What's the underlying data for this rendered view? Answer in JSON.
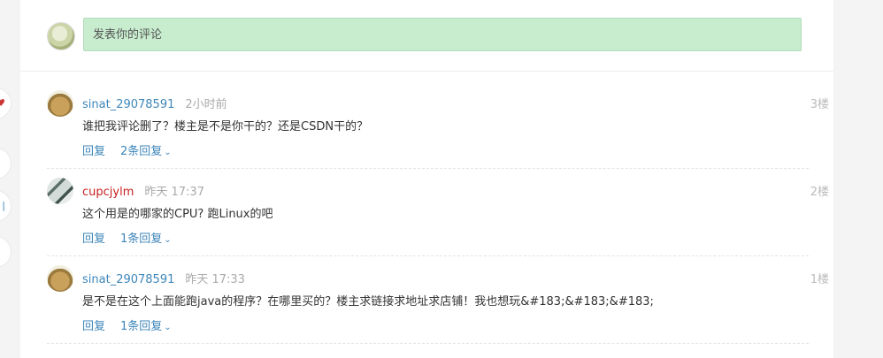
{
  "compose": {
    "placeholder": "发表你的评论"
  },
  "comments": [
    {
      "user": "sinat_29078591",
      "time": "2小时前",
      "floor": "3楼",
      "text": "谁把我评论删了？楼主是不是你干的？还是CSDN干的？",
      "reply_label": "回复",
      "replies_label": "2条回复",
      "user_color": "#3e86b9"
    },
    {
      "user": "cupcjylm",
      "time": "昨天 17:37",
      "floor": "2楼",
      "text": "这个用是的哪家的CPU? 跑Linux的吧",
      "reply_label": "回复",
      "replies_label": "1条回复",
      "user_color": "#c91f1f"
    },
    {
      "user": "sinat_29078591",
      "time": "昨天 17:33",
      "floor": "1楼",
      "text": "是不是在这个上面能跑java的程序？在哪里买的？楼主求链接求地址求店铺！我也想玩&#183;&#183;&#183;",
      "reply_label": "回复",
      "replies_label": "1条回复",
      "user_color": "#3e86b9"
    }
  ],
  "icons": {
    "chevron": "chevron-down-icon",
    "side_buttons": [
      "heart-icon",
      "bookmark-icon",
      "share-icon",
      "more-icon"
    ]
  }
}
